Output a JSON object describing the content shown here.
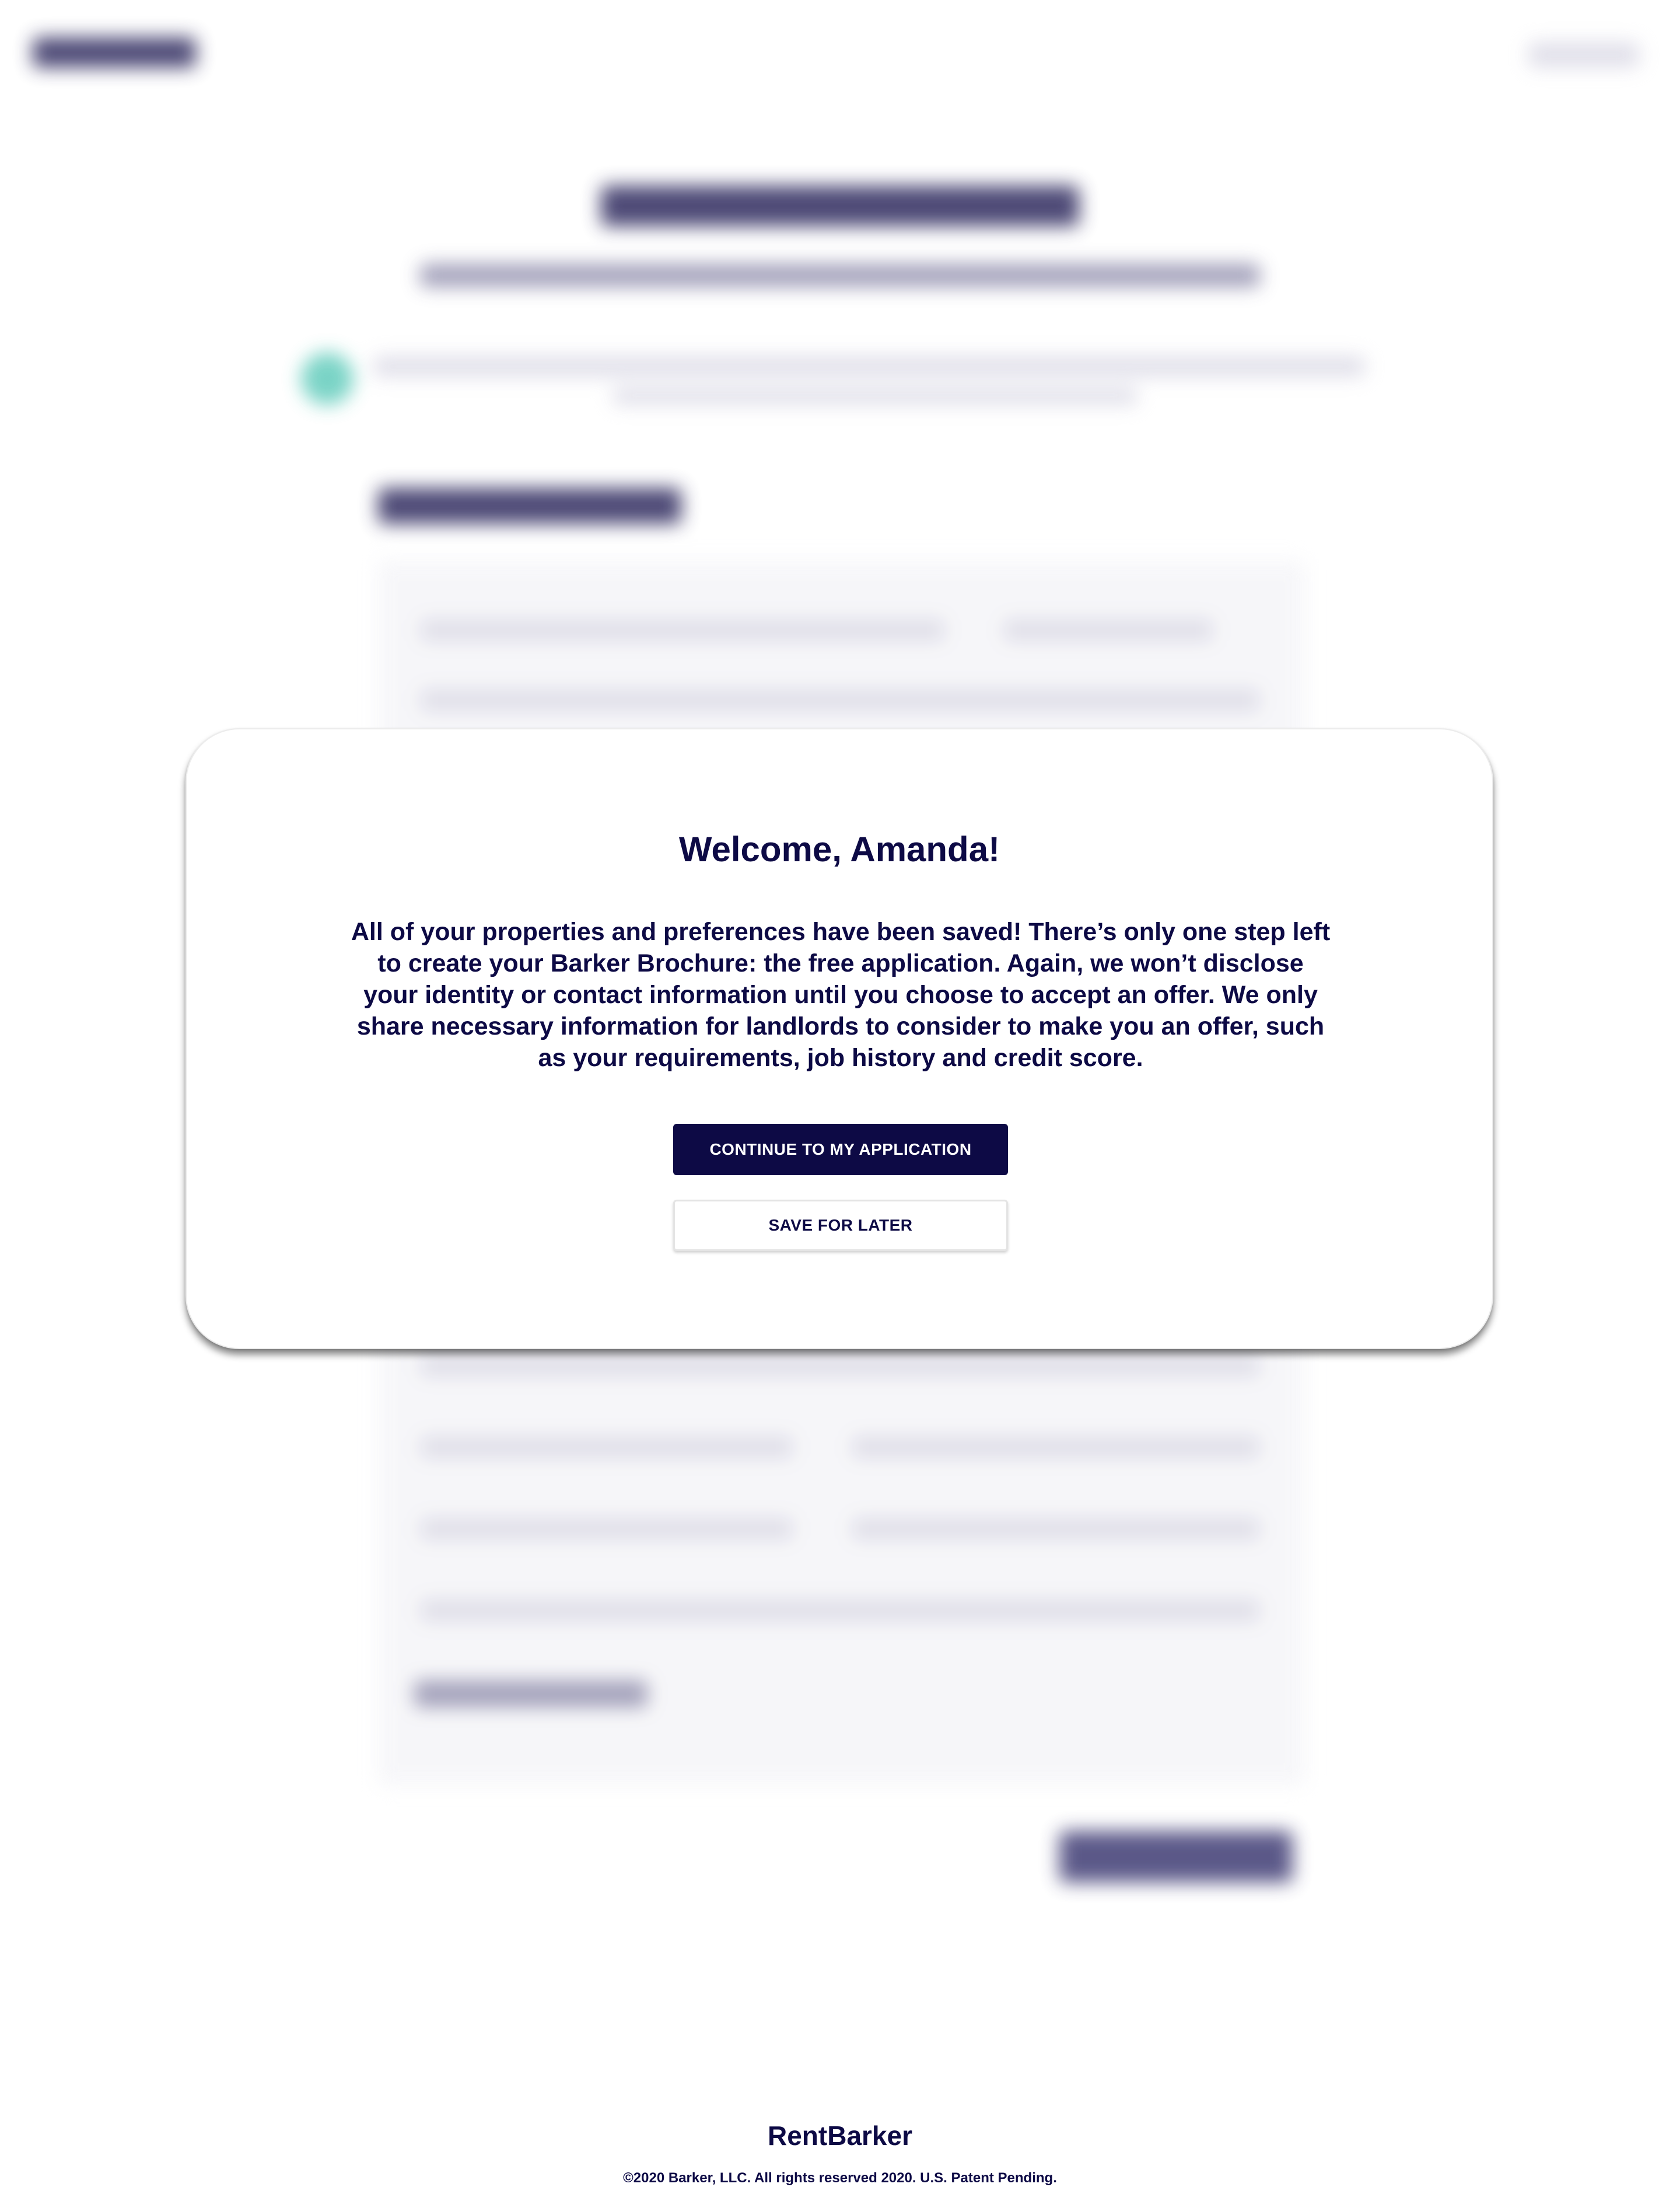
{
  "modal": {
    "title": "Welcome, Amanda!",
    "message": "All of your properties and preferences have been saved! There’s only one step left to create your Barker Brochure: the free application. Again, we won’t disclose your identity or contact information until you choose to accept an offer. We only share necessary information for landlords to consider to make you an offer, such as your requirements, job history and credit score.",
    "continue_label": "CONTINUE TO MY APPLICATION",
    "save_later_label": "SAVE FOR LATER"
  },
  "footer": {
    "brand": "RentBarker",
    "copyright": "©2020 Barker, LLC. All rights reserved 2020. U.S. Patent Pending."
  },
  "colors": {
    "brand_navy": "#0d0a45",
    "background": "#ffffff",
    "accent_teal": "#6ccfc0"
  },
  "icons": {
    "info_badge": "teal-circle-icon"
  }
}
